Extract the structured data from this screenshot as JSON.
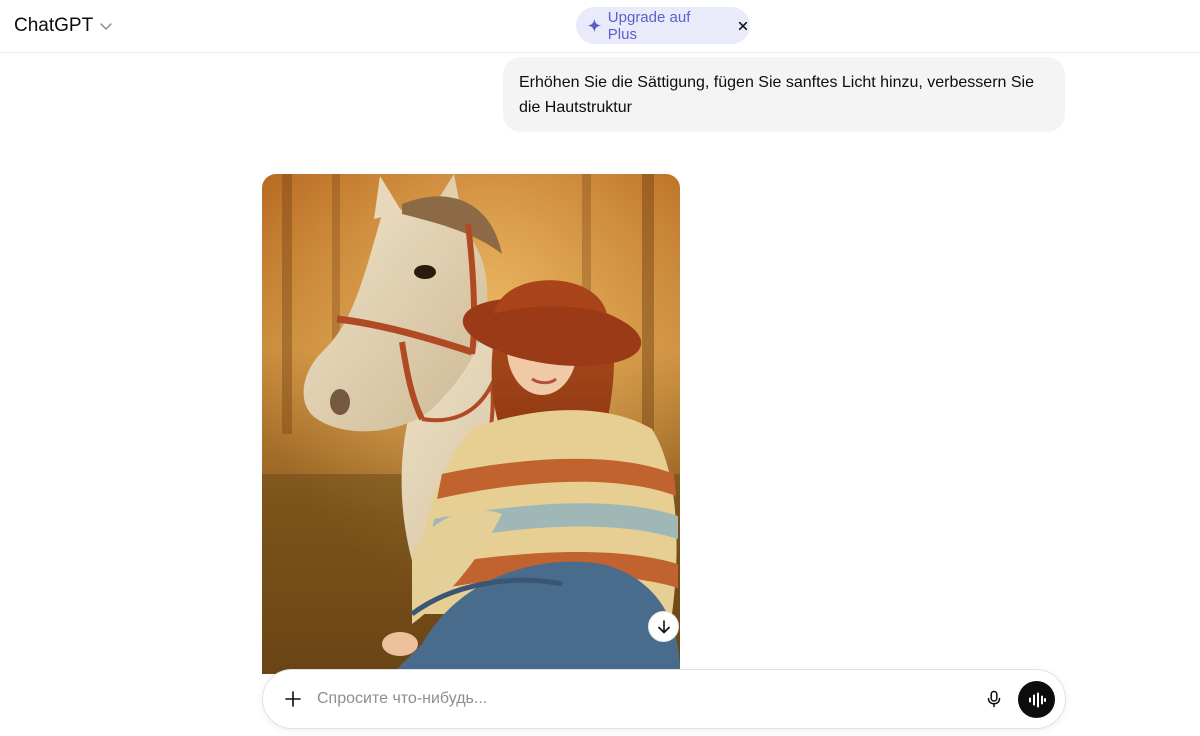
{
  "header": {
    "model_name": "ChatGPT",
    "upgrade_label": "Upgrade auf Plus"
  },
  "conversation": {
    "user_message": "Erhöhen Sie die Sättigung, fügen Sie sanftes Licht hinzu, verbessern Sie die Hautstruktur"
  },
  "composer": {
    "placeholder": "Спросите что-нибудь..."
  },
  "colors": {
    "accent": "#5b5fd0",
    "pill_bg": "#e9ebfa",
    "bubble_bg": "#f4f4f4",
    "voice_btn_bg": "#0d0d0d"
  },
  "icons": {
    "model_dropdown": "chevron-down-icon",
    "upgrade": "sparkle-icon",
    "dismiss": "close-icon",
    "download": "arrow-down-icon",
    "attach": "plus-icon",
    "dictate": "microphone-icon",
    "voice_mode": "waveform-icon"
  }
}
